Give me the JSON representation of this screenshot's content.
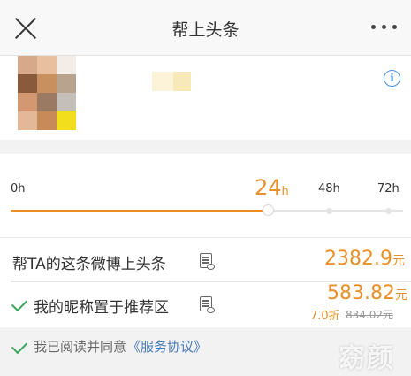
{
  "header": {
    "title": "帮上头条",
    "close_icon": "close-icon",
    "more_icon": "more-dots-icon"
  },
  "post": {
    "thumbnail_icon": "post-thumbnail-pixelated",
    "info_icon": "info-icon",
    "info_glyph": "i"
  },
  "duration": {
    "options": [
      "0h",
      "24",
      "48h",
      "72h"
    ],
    "selected_unit": "h",
    "selected_label": "24"
  },
  "promo_option": {
    "label": "帮TA的这条微博上头条",
    "price": "2382.9",
    "unit": "元"
  },
  "nickname_option": {
    "label": "我的昵称置于推荐区",
    "price": "583.82",
    "unit": "元",
    "discount": "7.0折",
    "original_price": "834.02元",
    "checked": true
  },
  "agreement": {
    "text": "我已阅读并同意",
    "link": "《服务协议》",
    "checked": true
  },
  "watermark": "窈颜",
  "colors": {
    "accent": "#e8912a",
    "check": "#3aa55b",
    "link": "#4a7bb7",
    "info": "#4a90d9"
  }
}
